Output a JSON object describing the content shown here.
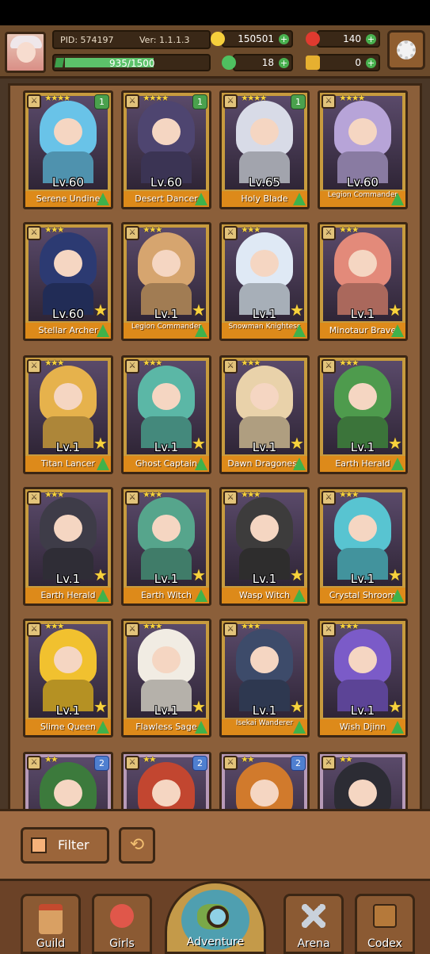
{
  "header": {
    "pid": "PID: 574197",
    "version": "Ver: 1.1.1.3",
    "xp_text": "935/1500",
    "xp_progress": 0.623,
    "gold": "150501",
    "gems": "140",
    "clover": "18",
    "key": "0"
  },
  "cards": [
    {
      "level": "Lv.60",
      "name": "Serene Undine",
      "stars": "★★★★",
      "badge": "1",
      "accent": "#69c3e8"
    },
    {
      "level": "Lv.60",
      "name": "Desert Dancer",
      "stars": "★★★★",
      "badge": "1",
      "accent": "#4e4570"
    },
    {
      "level": "Lv.65",
      "name": "Holy Blade",
      "stars": "★★★★",
      "badge": "1",
      "accent": "#d8dbe7"
    },
    {
      "level": "Lv.60",
      "name": "Legion Commander",
      "stars": "★★★★",
      "badge": "",
      "accent": "#b7a4d8"
    },
    {
      "level": "Lv.60",
      "name": "Stellar Archer",
      "stars": "★★★",
      "badge": "",
      "accent": "#2c3a72"
    },
    {
      "level": "Lv.1",
      "name": "Legion Commander",
      "stars": "★★★",
      "badge": "",
      "accent": "#d6a56f"
    },
    {
      "level": "Lv.1",
      "name": "Snowman Knightess",
      "stars": "★★★",
      "badge": "",
      "accent": "#dfe9f5"
    },
    {
      "level": "Lv.1",
      "name": "Minotaur Brave",
      "stars": "★★★",
      "badge": "",
      "accent": "#e38a7a"
    },
    {
      "level": "Lv.1",
      "name": "Titan Lancer",
      "stars": "★★★",
      "badge": "",
      "accent": "#e6b24c"
    },
    {
      "level": "Lv.1",
      "name": "Ghost Captain",
      "stars": "★★★",
      "badge": "",
      "accent": "#5bb7a6"
    },
    {
      "level": "Lv.1",
      "name": "Dawn Dragoness",
      "stars": "★★★",
      "badge": "",
      "accent": "#e9d2aa"
    },
    {
      "level": "Lv.1",
      "name": "Earth Herald",
      "stars": "★★★",
      "badge": "",
      "accent": "#4e9b4d"
    },
    {
      "level": "Lv.1",
      "name": "Earth Herald",
      "stars": "★★★",
      "badge": "",
      "accent": "#3e3c48"
    },
    {
      "level": "Lv.1",
      "name": "Earth Witch",
      "stars": "★★★",
      "badge": "",
      "accent": "#56a58c"
    },
    {
      "level": "Lv.1",
      "name": "Wasp Witch",
      "stars": "★★★",
      "badge": "",
      "accent": "#3d3c3c"
    },
    {
      "level": "Lv.1",
      "name": "Crystal Shroom",
      "stars": "★★★",
      "badge": "",
      "accent": "#58c4d1"
    },
    {
      "level": "Lv.1",
      "name": "Slime Queen",
      "stars": "★★★",
      "badge": "",
      "accent": "#f1c12f"
    },
    {
      "level": "Lv.1",
      "name": "Flawless Sage",
      "stars": "★★★",
      "badge": "",
      "accent": "#f1ece3"
    },
    {
      "level": "Lv.1",
      "name": "Isekai Wanderer",
      "stars": "★★★",
      "badge": "",
      "accent": "#3d4b6a"
    },
    {
      "level": "Lv.1",
      "name": "Wish Djinn",
      "stars": "★★★",
      "badge": "",
      "accent": "#7b5bc8"
    },
    {
      "level": "",
      "name": "",
      "stars": "★★",
      "badge": "2",
      "accent": "#3c7a3c"
    },
    {
      "level": "",
      "name": "",
      "stars": "★★",
      "badge": "2",
      "accent": "#c24630"
    },
    {
      "level": "",
      "name": "",
      "stars": "★★",
      "badge": "2",
      "accent": "#d17a2c"
    },
    {
      "level": "",
      "name": "",
      "stars": "★★",
      "badge": "",
      "accent": "#2c2c34"
    }
  ],
  "filter": {
    "label": "Filter"
  },
  "nav": [
    {
      "label": "Guild"
    },
    {
      "label": "Girls"
    },
    {
      "label": "Adventure"
    },
    {
      "label": "Arena"
    },
    {
      "label": "Codex"
    }
  ]
}
